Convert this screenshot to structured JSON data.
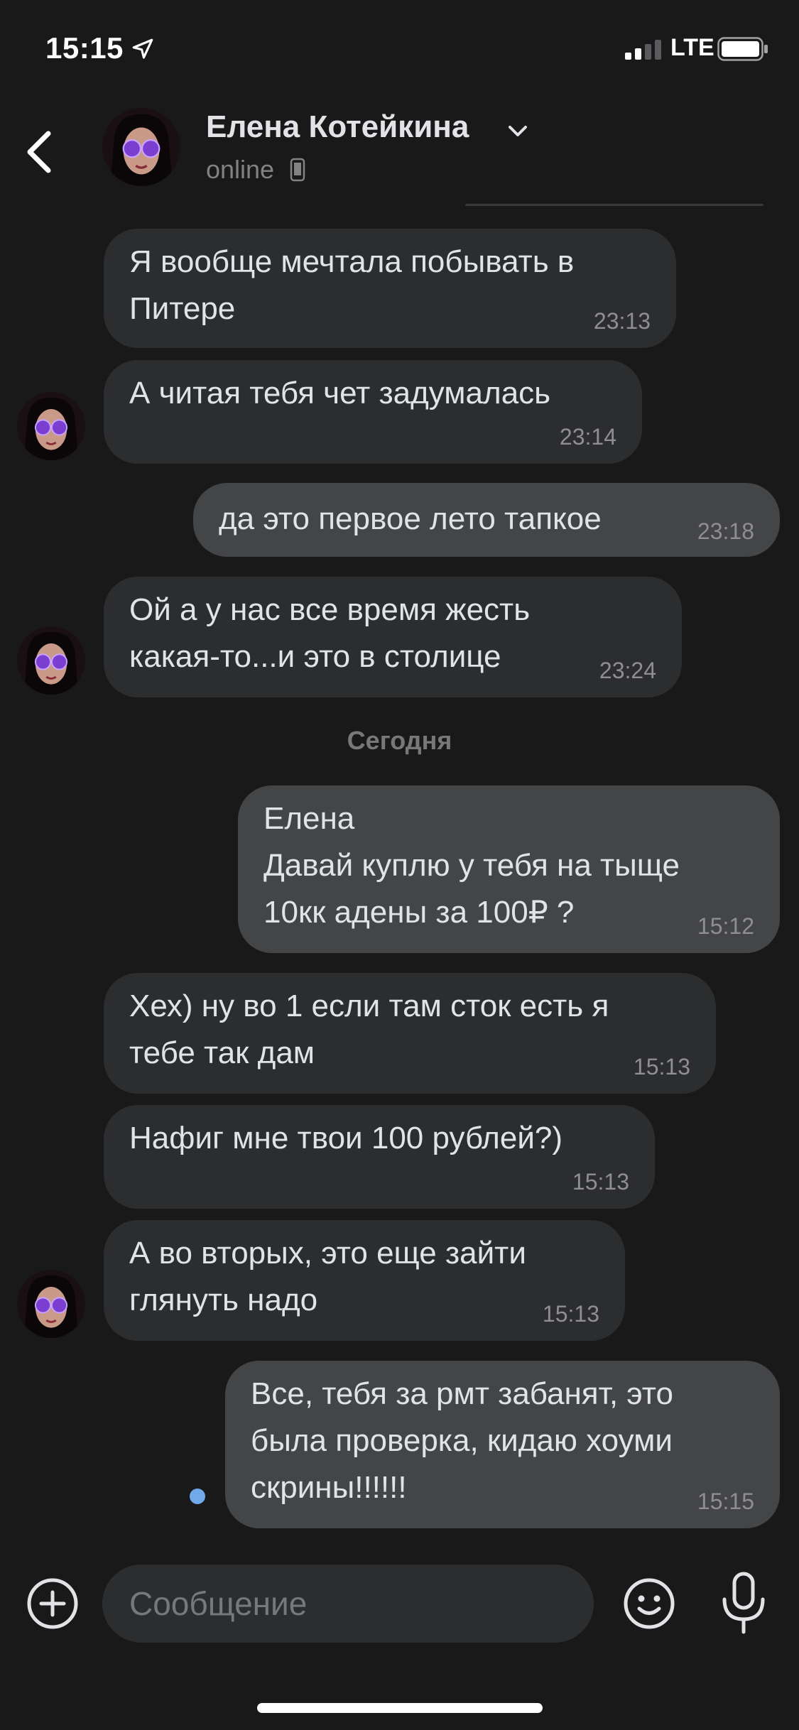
{
  "status_bar": {
    "time": "15:15",
    "network": "LTE"
  },
  "header": {
    "contact_name": "Елена Котейкина",
    "status": "online"
  },
  "date_separator": "Сегодня",
  "messages": [
    {
      "direction": "in",
      "lines": [
        "Я вообще мечтала побывать в",
        "Питере"
      ],
      "time": "23:13"
    },
    {
      "direction": "in",
      "lines": [
        "А читая тебя чет задумалась"
      ],
      "time": "23:14"
    },
    {
      "direction": "out",
      "lines": [
        "да это первое лето тапкое"
      ],
      "time": "23:18"
    },
    {
      "direction": "in",
      "lines": [
        "Ой а у нас все время жесть",
        "какая-то...и это в столице"
      ],
      "time": "23:24"
    },
    {
      "direction": "out",
      "lines": [
        "Елена",
        "Давай куплю у тебя на тыще",
        "10кк адены за 100₽ ?"
      ],
      "time": "15:12"
    },
    {
      "direction": "in",
      "lines": [
        "Хех) ну во 1 если там сток есть я",
        "тебе так дам"
      ],
      "time": "15:13"
    },
    {
      "direction": "in",
      "lines": [
        "Нафиг мне твои 100 рублей?)"
      ],
      "time": "15:13"
    },
    {
      "direction": "in",
      "lines": [
        "А во вторых, это еще зайти",
        "глянуть надо"
      ],
      "time": "15:13"
    },
    {
      "direction": "out",
      "lines": [
        "Все, тебя за рмт забанят, это",
        "была проверка, кидаю хоуми",
        "скрины!!!!!!"
      ],
      "time": "15:15",
      "unread": true
    }
  ],
  "composer": {
    "placeholder": "Сообщение"
  },
  "icons": {
    "back": "chevron-left-icon",
    "add": "plus-circle-icon",
    "emoji": "smile-icon",
    "mic": "microphone-icon"
  },
  "colors": {
    "background": "#19191a",
    "incoming_bubble": "#2c2d2e",
    "outgoing_bubble": "#444547",
    "unread_dot": "#71aaeb",
    "text": "#e1e3e6",
    "secondary_text": "#828282"
  }
}
